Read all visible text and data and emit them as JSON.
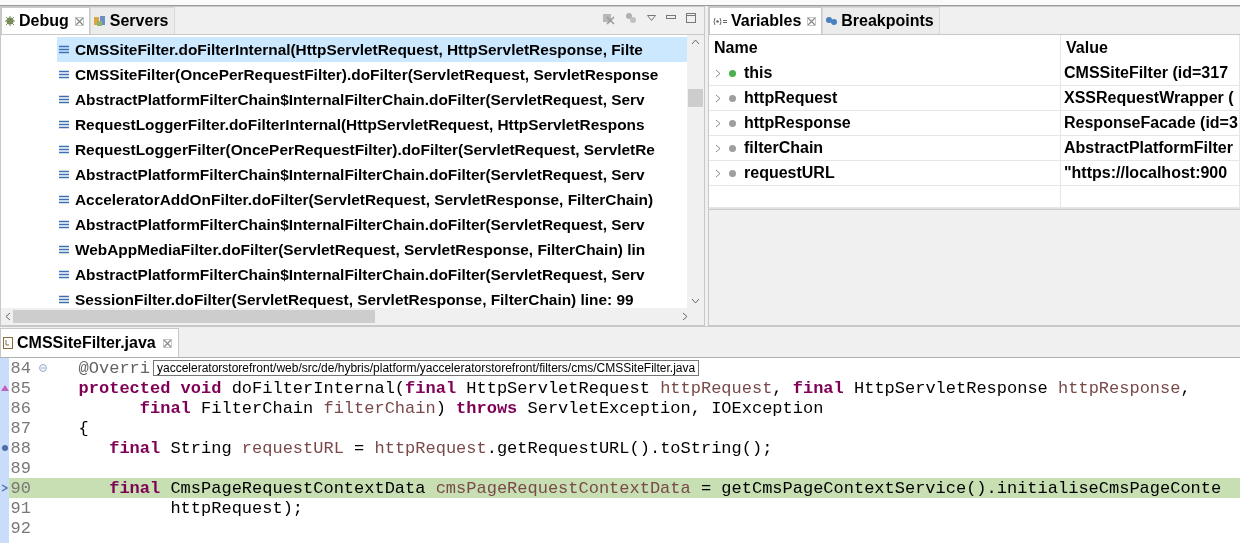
{
  "debug_panel": {
    "tabs": [
      {
        "label": "Debug",
        "selected": true,
        "closable": true
      },
      {
        "label": "Servers",
        "selected": false,
        "closable": false
      }
    ],
    "frames": [
      {
        "text": "CMSSiteFilter.doFilterInternal(HttpServletRequest, HttpServletResponse, Filte",
        "selected": true
      },
      {
        "text": "CMSSiteFilter(OncePerRequestFilter).doFilter(ServletRequest, ServletResponse",
        "selected": false
      },
      {
        "text": "AbstractPlatformFilterChain$InternalFilterChain.doFilter(ServletRequest, Serv",
        "selected": false
      },
      {
        "text": "RequestLoggerFilter.doFilterInternal(HttpServletRequest, HttpServletRespons",
        "selected": false
      },
      {
        "text": "RequestLoggerFilter(OncePerRequestFilter).doFilter(ServletRequest, ServletRe",
        "selected": false
      },
      {
        "text": "AbstractPlatformFilterChain$InternalFilterChain.doFilter(ServletRequest, Serv",
        "selected": false
      },
      {
        "text": "AcceleratorAddOnFilter.doFilter(ServletRequest, ServletResponse, FilterChain)",
        "selected": false
      },
      {
        "text": "AbstractPlatformFilterChain$InternalFilterChain.doFilter(ServletRequest, Serv",
        "selected": false
      },
      {
        "text": "WebAppMediaFilter.doFilter(ServletRequest, ServletResponse, FilterChain) lin",
        "selected": false
      },
      {
        "text": "AbstractPlatformFilterChain$InternalFilterChain.doFilter(ServletRequest, Serv",
        "selected": false
      },
      {
        "text": "SessionFilter.doFilter(ServletRequest, ServletResponse, FilterChain) line: 99",
        "selected": false
      }
    ]
  },
  "variables_panel": {
    "tabs": [
      {
        "label": "Variables",
        "selected": true,
        "closable": true
      },
      {
        "label": "Breakpoints",
        "selected": false,
        "closable": false
      }
    ],
    "columns": [
      "Name",
      "Value"
    ],
    "rows": [
      {
        "name": "this",
        "value": "CMSSiteFilter  (id=317",
        "color": "#4caf50"
      },
      {
        "name": "httpRequest",
        "value": "XSSRequestWrapper  (",
        "color": "#9e9e9e"
      },
      {
        "name": "httpResponse",
        "value": "ResponseFacade  (id=3",
        "color": "#9e9e9e"
      },
      {
        "name": "filterChain",
        "value": "AbstractPlatformFilter",
        "color": "#9e9e9e"
      },
      {
        "name": "requestURL",
        "value": "\"https://localhost:900",
        "color": "#9e9e9e"
      }
    ]
  },
  "editor": {
    "tab": {
      "label": "CMSSiteFilter.java",
      "selected": true
    },
    "tooltip": "yacceleratorstorefront/web/src/de/hybris/platform/yacceleratorstorefront/filters/cms/CMSSiteFilter.java",
    "lines": [
      {
        "number": "84",
        "current": false,
        "tokens": [
          {
            "kind": "annotation",
            "text": "   @Overri"
          }
        ]
      },
      {
        "number": "85",
        "current": false,
        "tokens": [
          {
            "kind": "keyword",
            "text": "   protected void "
          },
          {
            "kind": "plain",
            "text": "doFilterInternal("
          },
          {
            "kind": "keyword",
            "text": "final "
          },
          {
            "kind": "plain",
            "text": "HttpServletRequest "
          },
          {
            "kind": "variable",
            "text": "httpRequest"
          },
          {
            "kind": "plain",
            "text": ", "
          },
          {
            "kind": "keyword",
            "text": "final "
          },
          {
            "kind": "plain",
            "text": "HttpServletResponse "
          },
          {
            "kind": "variable",
            "text": "httpResponse"
          },
          {
            "kind": "plain",
            "text": ","
          }
        ]
      },
      {
        "number": "86",
        "current": false,
        "tokens": [
          {
            "kind": "keyword",
            "text": "         final "
          },
          {
            "kind": "plain",
            "text": "FilterChain "
          },
          {
            "kind": "variable",
            "text": "filterChain"
          },
          {
            "kind": "plain",
            "text": ") "
          },
          {
            "kind": "keyword",
            "text": "throws "
          },
          {
            "kind": "plain",
            "text": "ServletException, IOException"
          }
        ]
      },
      {
        "number": "87",
        "current": false,
        "tokens": [
          {
            "kind": "plain",
            "text": "   {"
          }
        ]
      },
      {
        "number": "88",
        "current": false,
        "tokens": [
          {
            "kind": "keyword",
            "text": "      final "
          },
          {
            "kind": "plain",
            "text": "String "
          },
          {
            "kind": "variable",
            "text": "requestURL"
          },
          {
            "kind": "plain",
            "text": " = "
          },
          {
            "kind": "variable",
            "text": "httpRequest"
          },
          {
            "kind": "plain",
            "text": ".getRequestURL().toString();"
          }
        ]
      },
      {
        "number": "89",
        "current": false
      },
      {
        "number": "90",
        "current": true,
        "tokens": [
          {
            "kind": "keyword",
            "text": "      final "
          },
          {
            "kind": "plain",
            "text": "CmsPageRequestContextData "
          },
          {
            "kind": "variable",
            "text": "cmsPageRequestContextData"
          },
          {
            "kind": "plain",
            "text": " = getCmsPageContextService().initialiseCmsPageConte"
          }
        ]
      },
      {
        "number": "91",
        "current": false,
        "tokens": [
          {
            "kind": "plain",
            "text": "            httpRequest);"
          }
        ]
      },
      {
        "number": "92",
        "current": false
      }
    ]
  }
}
